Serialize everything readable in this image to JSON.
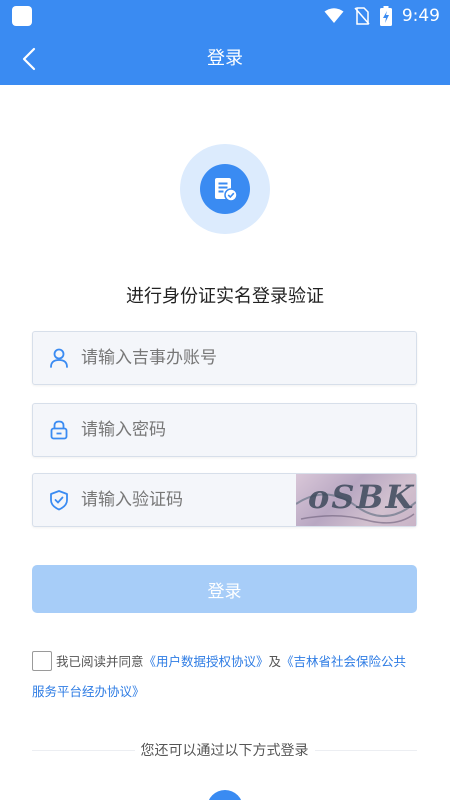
{
  "status_bar": {
    "time": "9:49"
  },
  "header": {
    "title": "登录",
    "back_icon": "chevron-left-icon"
  },
  "hero": {
    "icon": "verified-document-icon",
    "subtitle": "进行身份证实名登录验证"
  },
  "form": {
    "account": {
      "placeholder": "请输入吉事办账号",
      "icon": "user-icon",
      "value": ""
    },
    "password": {
      "placeholder": "请输入密码",
      "icon": "lock-icon",
      "value": ""
    },
    "captcha": {
      "placeholder": "请输入验证码",
      "icon": "shield-check-icon",
      "value": "",
      "image_text": "oSBK"
    },
    "submit_label": "登录"
  },
  "agreement": {
    "prefix": "我已阅读并同意",
    "link1": "《用户数据授权协议》",
    "conjunction": "及",
    "link2_part1": "《吉林省社会保险公共",
    "link2_part2": "服务平台经办协议》",
    "checked": false
  },
  "alt_login": {
    "label": "您还可以通过以下方式登录"
  },
  "colors": {
    "primary": "#3A8BF2",
    "button_disabled": "#A7CDF8",
    "link": "#2E7CE4"
  }
}
